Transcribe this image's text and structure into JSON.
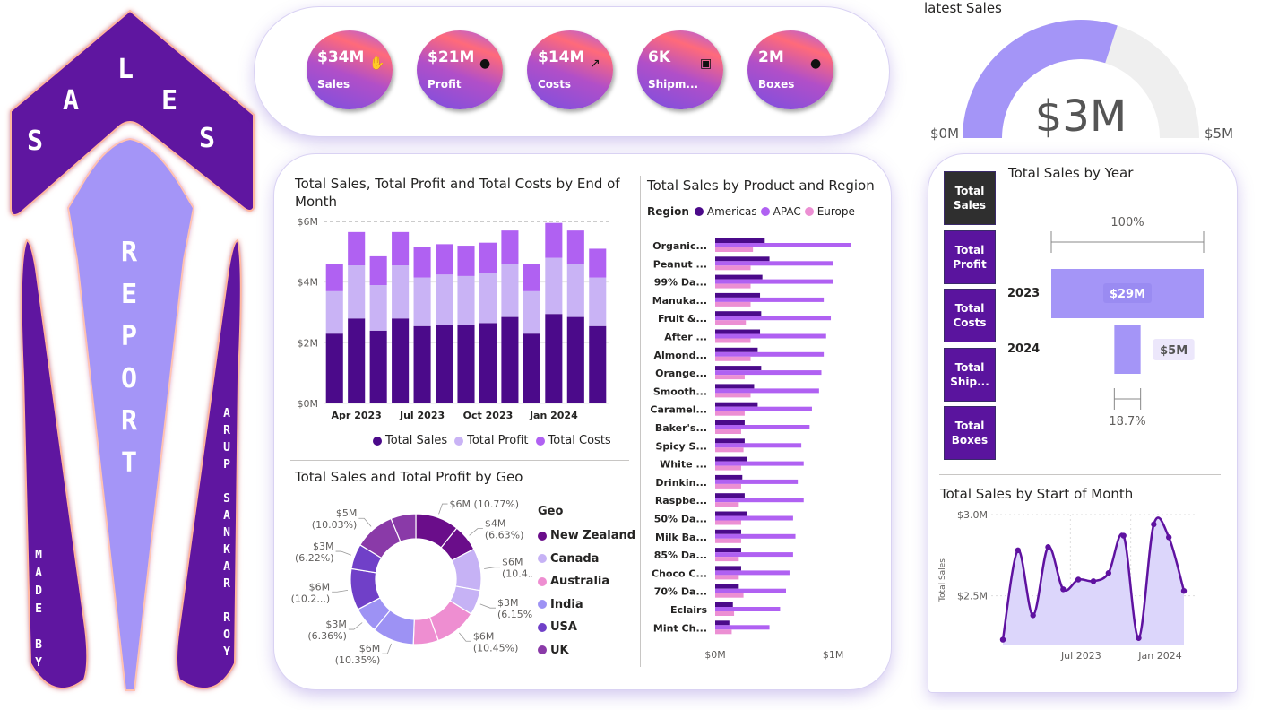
{
  "banner": {
    "sales_letters": [
      "S",
      "A",
      "L",
      "E",
      "S"
    ],
    "report_letters": [
      "R",
      "E",
      "P",
      "O",
      "R",
      "T"
    ],
    "made_by_letters": [
      "M",
      "A",
      "D",
      "E",
      "",
      "B",
      "Y"
    ],
    "author_letters": [
      "A",
      "R",
      "U",
      "P",
      "",
      "S",
      "A",
      "N",
      "K",
      "A",
      "R",
      "",
      "R",
      "O",
      "Y"
    ]
  },
  "kpis": [
    {
      "value": "$34M",
      "label": "Sales",
      "icon": "hand-money-icon"
    },
    {
      "value": "$21M",
      "label": "Profit",
      "icon": "money-bag-icon"
    },
    {
      "value": "$14M",
      "label": "Costs",
      "icon": "cost-chart-icon"
    },
    {
      "value": "6K",
      "label": "Shipm...",
      "icon": "shipment-icon"
    },
    {
      "value": "2M",
      "label": "Boxes",
      "icon": "box-icon"
    }
  ],
  "gauge": {
    "title": "latest Sales",
    "value_label": "$3M",
    "min_label": "$0M",
    "max_label": "$5M",
    "value": 3,
    "min": 0,
    "max": 5,
    "fill_color": "#a495f7",
    "track_color": "#efefef"
  },
  "tiles": [
    {
      "label": "Total Sales",
      "active": true
    },
    {
      "label": "Total Profit",
      "active": false
    },
    {
      "label": "Total Costs",
      "active": false
    },
    {
      "label": "Total Ship...",
      "active": false
    },
    {
      "label": "Total Boxes",
      "active": false
    }
  ],
  "colors": {
    "dark_purple": "#4b0a8a",
    "light_purple": "#c9b3f5",
    "mid_purple": "#b061f2",
    "pink": "#ec8fd3",
    "banner_purple": "#5f12a0",
    "banner_lavender": "#a495f7"
  },
  "chart_data": [
    {
      "id": "month_stack",
      "type": "bar",
      "title": "Total Sales, Total Profit and Total Costs by End of Month",
      "stacked": true,
      "x": [
        "2023-02",
        "2023-03",
        "2023-04",
        "2023-05",
        "2023-06",
        "2023-07",
        "2023-08",
        "2023-09",
        "2023-10",
        "2023-11",
        "2023-12",
        "2024-01",
        "2024-02",
        "2024-03",
        "2024-04"
      ],
      "x_ticks": [
        "Apr 2023",
        "Jul 2023",
        "Oct 2023",
        "Jan 2024"
      ],
      "series": [
        {
          "name": "Total Sales",
          "values": [
            2.3,
            2.8,
            2.4,
            2.8,
            2.55,
            2.6,
            2.6,
            2.65,
            2.85,
            2.3,
            2.95,
            2.85,
            2.55
          ]
        },
        {
          "name": "Total Profit",
          "values": [
            1.4,
            1.75,
            1.5,
            1.75,
            1.6,
            1.65,
            1.6,
            1.65,
            1.75,
            1.4,
            1.85,
            1.75,
            1.6
          ]
        },
        {
          "name": "Total Costs",
          "values": [
            0.9,
            1.1,
            0.95,
            1.1,
            1.0,
            1.0,
            1.0,
            1.0,
            1.1,
            0.9,
            1.15,
            1.1,
            0.95
          ]
        }
      ],
      "y_ticks": [
        "$0M",
        "$2M",
        "$4M",
        "$6M"
      ],
      "ylim": [
        0,
        6
      ],
      "legend": "bottom"
    },
    {
      "id": "product_region",
      "type": "bar",
      "orientation": "horizontal",
      "title": "Total Sales by Product and Region",
      "legend_title": "Region",
      "categories": [
        "Organic...",
        "Peanut ...",
        "99% Da...",
        "Manuka...",
        "Fruit &...",
        "After ...",
        "Almond...",
        "Orange...",
        "Smooth...",
        "Caramel...",
        "Baker's...",
        "Spicy S...",
        "White ...",
        "Drinkin...",
        "Raspbe...",
        "50% Da...",
        "Milk Ba...",
        "85% Da...",
        "Choco C...",
        "70% Da...",
        "Eclairs",
        "Mint Ch..."
      ],
      "series": [
        {
          "name": "Americas",
          "values": [
            0.42,
            0.46,
            0.4,
            0.38,
            0.39,
            0.38,
            0.36,
            0.39,
            0.33,
            0.36,
            0.25,
            0.25,
            0.27,
            0.23,
            0.25,
            0.27,
            0.22,
            0.22,
            0.22,
            0.2,
            0.15,
            0.12
          ]
        },
        {
          "name": "APAC",
          "values": [
            1.15,
            1.0,
            1.0,
            0.92,
            0.98,
            0.94,
            0.92,
            0.9,
            0.88,
            0.82,
            0.8,
            0.73,
            0.75,
            0.7,
            0.75,
            0.66,
            0.68,
            0.66,
            0.63,
            0.6,
            0.55,
            0.46
          ]
        },
        {
          "name": "Europe",
          "values": [
            0.32,
            0.3,
            0.3,
            0.3,
            0.26,
            0.3,
            0.3,
            0.25,
            0.3,
            0.25,
            0.22,
            0.24,
            0.22,
            0.22,
            0.2,
            0.22,
            0.22,
            0.2,
            0.2,
            0.24,
            0.16,
            0.14
          ]
        }
      ],
      "x_ticks": [
        "$0M",
        "$1M"
      ],
      "xlim": [
        0,
        1.2
      ],
      "legend": "top-left"
    },
    {
      "id": "geo_donut",
      "type": "pie",
      "donut": true,
      "title": "Total Sales and Total Profit by Geo",
      "legend_title": "Geo",
      "slices": [
        {
          "group": "New Zealand",
          "label": "$6M (10.77%)",
          "value": 10.77,
          "color": "#6a0d8a"
        },
        {
          "group": "New Zealand",
          "label": "$4M (6.63%)",
          "value": 6.63,
          "color": "#6a0d8a"
        },
        {
          "group": "Canada",
          "label": "$6M (10.4...)",
          "value": 10.4,
          "color": "#c6b2f5"
        },
        {
          "group": "Canada",
          "label": "$3M (6.15%)",
          "value": 6.15,
          "color": "#c6b2f5"
        },
        {
          "group": "Australia",
          "label": "$6M (10.45%)",
          "value": 10.45,
          "color": "#ee8ed1"
        },
        {
          "group": "Australia",
          "label": "",
          "value": 6.2,
          "color": "#ee8ed1"
        },
        {
          "group": "India",
          "label": "$6M (10.35%)",
          "value": 10.35,
          "color": "#9d92f4"
        },
        {
          "group": "India",
          "label": "$3M (6.36%)",
          "value": 6.36,
          "color": "#9d92f4"
        },
        {
          "group": "USA",
          "label": "$6M (10.2...)",
          "value": 10.2,
          "color": "#7040c8"
        },
        {
          "group": "USA",
          "label": "$3M (6.22%)",
          "value": 6.22,
          "color": "#7040c8"
        },
        {
          "group": "UK",
          "label": "$5M (10.03%)",
          "value": 10.03,
          "color": "#8a3aa8"
        },
        {
          "group": "UK",
          "label": "",
          "value": 6.2,
          "color": "#8a3aa8"
        }
      ],
      "legend_items": [
        {
          "name": "New Zealand",
          "color": "#6a0d8a"
        },
        {
          "name": "Canada",
          "color": "#c6b2f5"
        },
        {
          "name": "Australia",
          "color": "#ee8ed1"
        },
        {
          "name": "India",
          "color": "#9d92f4"
        },
        {
          "name": "USA",
          "color": "#7040c8"
        },
        {
          "name": "UK",
          "color": "#8a3aa8"
        }
      ],
      "legend": "right"
    },
    {
      "id": "year_funnel",
      "type": "bar",
      "orientation": "horizontal",
      "title": "Total Sales by Year",
      "categories": [
        "2023",
        "2024"
      ],
      "values": [
        29,
        5
      ],
      "data_labels": [
        "$29M",
        "$5M"
      ],
      "top_percent_label": "100%",
      "bottom_percent_label": "18.7%"
    },
    {
      "id": "month_line",
      "type": "area",
      "title": "Total Sales by Start of Month",
      "ylabel": "Total Sales",
      "x_ticks": [
        "Jul 2023",
        "Jan 2024"
      ],
      "y_ticks": [
        "$2.5M",
        "$3.0M"
      ],
      "x": [
        "2023-01",
        "2023-02",
        "2023-03",
        "2023-04",
        "2023-05",
        "2023-06",
        "2023-07",
        "2023-08",
        "2023-09",
        "2023-10",
        "2023-11",
        "2023-12",
        "2024-01",
        "2024-02",
        "2024-03"
      ],
      "values": [
        2.23,
        2.78,
        2.38,
        2.8,
        2.54,
        2.6,
        2.59,
        2.64,
        2.87,
        2.24,
        2.94,
        2.86,
        2.53
      ],
      "ylim": [
        2.2,
        3.0
      ]
    }
  ]
}
